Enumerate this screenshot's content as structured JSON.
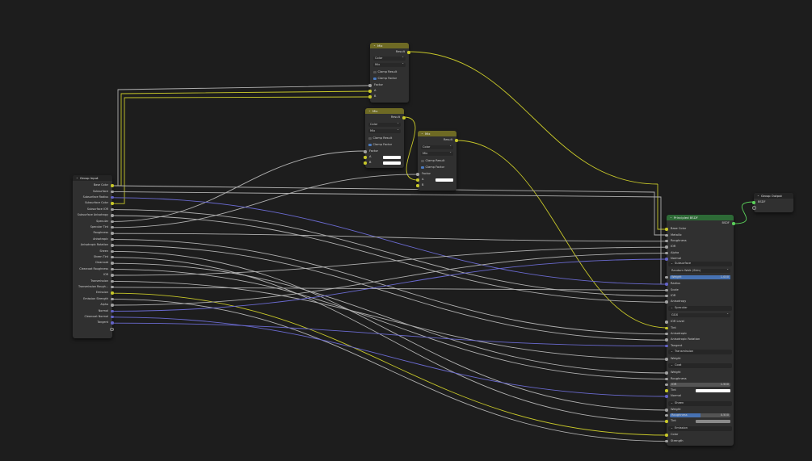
{
  "colors": {
    "color_socket": "#c7c729",
    "float_socket": "#a1a1a1",
    "vector_socket": "#6363c7",
    "mix_header": "#6e6a24",
    "bsdf_header": "#2d6a36"
  },
  "mix1": {
    "title": "Mix",
    "result": "Result",
    "data_type": "Color",
    "blend": "Mix",
    "clamp_result": "Clamp Result",
    "clamp_factor": "Clamp Factor",
    "clamp_result_on": false,
    "clamp_factor_on": true,
    "factor": "Factor",
    "a": "A",
    "b": "B"
  },
  "mix2": {
    "title": "Mix",
    "result": "Result",
    "data_type": "Color",
    "blend": "Mix",
    "clamp_result": "Clamp Result",
    "clamp_factor": "Clamp Factor",
    "clamp_result_on": false,
    "clamp_factor_on": true,
    "factor": "Factor",
    "a": "A",
    "b": "B"
  },
  "mix3": {
    "title": "Mix",
    "result": "Result",
    "data_type": "Color",
    "blend": "Mix",
    "clamp_result": "Clamp Result",
    "clamp_factor": "Clamp Factor",
    "clamp_result_on": false,
    "clamp_factor_on": true,
    "factor": "Factor",
    "a": "A",
    "b": "B"
  },
  "group_input": {
    "title": "Group Input",
    "sockets": [
      "Base Color",
      "Subsurface",
      "Subsurface Radius",
      "Subsurface Color",
      "Subsurface IOR",
      "Subsurface Anisotropy",
      "Specular",
      "Specular Tint",
      "Roughness",
      "Anisotropic",
      "Anisotropic Rotation",
      "Sheen",
      "Sheen Tint",
      "Clearcoat",
      "Clearcoat Roughness",
      "IOR",
      "Transmission",
      "Transmission Rough...",
      "Emission",
      "Emission Strength",
      "Alpha",
      "Normal",
      "Clearcoat Normal",
      "Tangent"
    ]
  },
  "group_output": {
    "title": "Group Output",
    "bsdf": "BSDF"
  },
  "bsdf": {
    "title": "Principled BSDF",
    "output": "BSDF",
    "top": [
      "Base Color",
      "Metallic",
      "Roughness",
      "IOR",
      "Alpha",
      "Normal"
    ],
    "subsurface": {
      "panel": "Subsurface",
      "method": "Random Walk (Skin)",
      "weight_label": "Weight",
      "weight_value": "1.000",
      "rows": [
        "Radius",
        "Scale",
        "IOR",
        "Anisotropy"
      ]
    },
    "specular": {
      "panel": "Specular",
      "distribution": "GGX",
      "rows": [
        "IOR Level",
        "Tint",
        "Anisotropic",
        "Anisotropic Rotation",
        "Tangent"
      ]
    },
    "transmission": {
      "panel": "Transmission",
      "rows": [
        "Weight"
      ]
    },
    "coat": {
      "panel": "Coat",
      "rows": [
        "Weight",
        "Roughness"
      ],
      "ior_label": "IOR",
      "ior_value": "1.500",
      "tint": "Tint",
      "normal": "Normal"
    },
    "sheen": {
      "panel": "Sheen",
      "weight": "Weight",
      "roughness_label": "Roughness",
      "roughness_value": "0.500",
      "tint": "Tint"
    },
    "emission": {
      "panel": "Emission",
      "rows": [
        "Color",
        "Strength"
      ]
    }
  }
}
